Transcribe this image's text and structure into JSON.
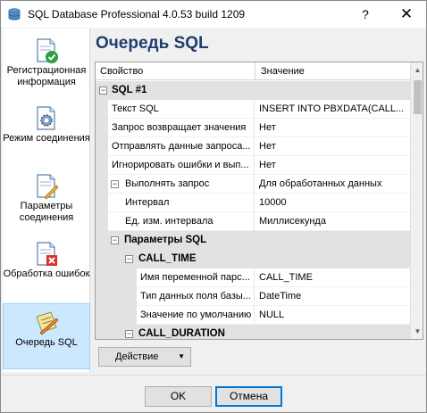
{
  "window": {
    "title": "SQL Database Professional 4.0.53 build 1209",
    "help_label": "?",
    "close_label": "✕"
  },
  "sidebar": {
    "items": [
      {
        "label": "Регистрационная информация",
        "icon": "document-check-icon"
      },
      {
        "label": "Режим соединения",
        "icon": "gear-document-icon"
      },
      {
        "label": "Параметры соединения",
        "icon": "document-pencil-icon"
      },
      {
        "label": "Обработка ошибок",
        "icon": "document-error-icon"
      },
      {
        "label": "Очередь SQL",
        "icon": "notepad-icon",
        "active": true
      }
    ]
  },
  "main": {
    "title": "Очередь SQL"
  },
  "grid": {
    "col_name": "Свойство",
    "col_value": "Значение",
    "rows": [
      {
        "type": "cat",
        "name": "SQL #1",
        "expander": "−"
      },
      {
        "type": "prop",
        "name": "Текст SQL",
        "value": "INSERT INTO PBXDATA(CALL..."
      },
      {
        "type": "prop",
        "name": "Запрос возвращает значения",
        "value": "Нет"
      },
      {
        "type": "prop",
        "name": "Отправлять данные запроса...",
        "value": "Нет"
      },
      {
        "type": "prop",
        "name": "Игнорировать ошибки и вып...",
        "value": "Нет"
      },
      {
        "type": "prop-exp",
        "name": "Выполнять запрос",
        "value": "Для обработанных данных",
        "expander": "−"
      },
      {
        "type": "prop2",
        "name": "Интервал",
        "value": "10000"
      },
      {
        "type": "prop2",
        "name": "Ед. изм. интервала",
        "value": "Миллисекунда"
      },
      {
        "type": "cat2",
        "name": "Параметры SQL",
        "expander": "−"
      },
      {
        "type": "cat3",
        "name": "CALL_TIME",
        "expander": "−"
      },
      {
        "type": "prop3",
        "name": "Имя переменной парс...",
        "value": "CALL_TIME"
      },
      {
        "type": "prop3",
        "name": "Тип данных поля базы...",
        "value": "DateTime"
      },
      {
        "type": "prop3",
        "name": "Значение по умолчанию",
        "value": "NULL"
      },
      {
        "type": "cat3",
        "name": "CALL_DURATION",
        "expander": "−"
      }
    ]
  },
  "actions": {
    "action_label": "Действие",
    "ok_label": "OK",
    "cancel_label": "Отмена"
  },
  "colors": {
    "title_blue": "#1e3d6b",
    "active_bg": "#cce8ff",
    "category_bg": "#e2e2e2",
    "focus_border": "#0078d7"
  }
}
